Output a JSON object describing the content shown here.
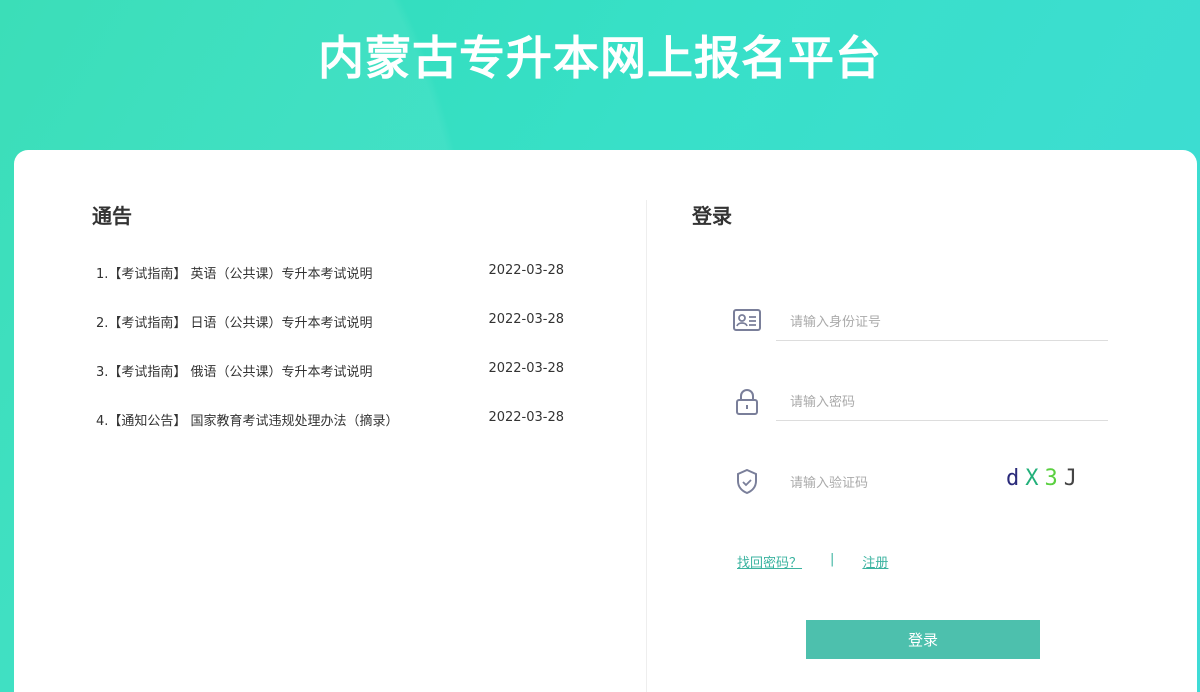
{
  "header": {
    "title": "内蒙古专升本网上报名平台"
  },
  "notices": {
    "heading": "通告",
    "items": [
      {
        "title": "1.【考试指南】 英语（公共课）专升本考试说明",
        "date": "2022-03-28"
      },
      {
        "title": "2.【考试指南】 日语（公共课）专升本考试说明",
        "date": "2022-03-28"
      },
      {
        "title": "3.【考试指南】 俄语（公共课）专升本考试说明",
        "date": "2022-03-28"
      },
      {
        "title": "4.【通知公告】 国家教育考试违规处理办法（摘录）",
        "date": "2022-03-28"
      }
    ]
  },
  "login": {
    "heading": "登录",
    "id_placeholder": "请输入身份证号",
    "password_placeholder": "请输入密码",
    "captcha_placeholder": "请输入验证码",
    "captcha": [
      {
        "ch": "d",
        "color": "#2a2a7a"
      },
      {
        "ch": "X",
        "color": "#22b07a"
      },
      {
        "ch": "3",
        "color": "#5ad040"
      },
      {
        "ch": "J",
        "color": "#444444"
      }
    ],
    "forgot": "找回密码？",
    "separator": "|",
    "register": "注册",
    "submit": "登录"
  }
}
